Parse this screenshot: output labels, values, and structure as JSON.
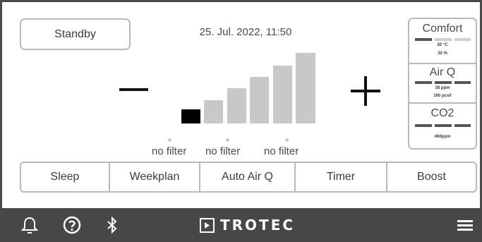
{
  "header": {
    "standby_label": "Standby",
    "datetime": "25. Jul. 2022, 11:50"
  },
  "fan_level": {
    "total_levels": 6,
    "active_level": 1,
    "decrease_symbol": "minus",
    "increase_symbol": "plus"
  },
  "filters": [
    {
      "label": "no filter"
    },
    {
      "label": "no filter"
    },
    {
      "label": "no filter"
    }
  ],
  "side_panel": {
    "comfort": {
      "title": "Comfort",
      "line1": "20 °C",
      "line2": "30 %"
    },
    "airq": {
      "title": "Air Q",
      "line1": "38 ppm",
      "line2": "160 pcs/l"
    },
    "co2": {
      "title": "CO2",
      "line1": "460ppm"
    }
  },
  "modes": [
    {
      "label": "Sleep"
    },
    {
      "label": "Weekplan"
    },
    {
      "label": "Auto Air Q"
    },
    {
      "label": "Timer"
    },
    {
      "label": "Boost"
    }
  ],
  "footer": {
    "brand": "TROTEC",
    "icons": [
      "bell-icon",
      "help-icon",
      "bluetooth-icon",
      "menu-icon"
    ]
  },
  "colors": {
    "frame": "#4a4a4a",
    "footer_bg": "#474747",
    "border": "#b9b9b9",
    "bar_inactive": "#c8c8c8",
    "bar_active": "#000000",
    "indicator_dark": "#555555",
    "indicator_light": "#cfcfcf"
  }
}
